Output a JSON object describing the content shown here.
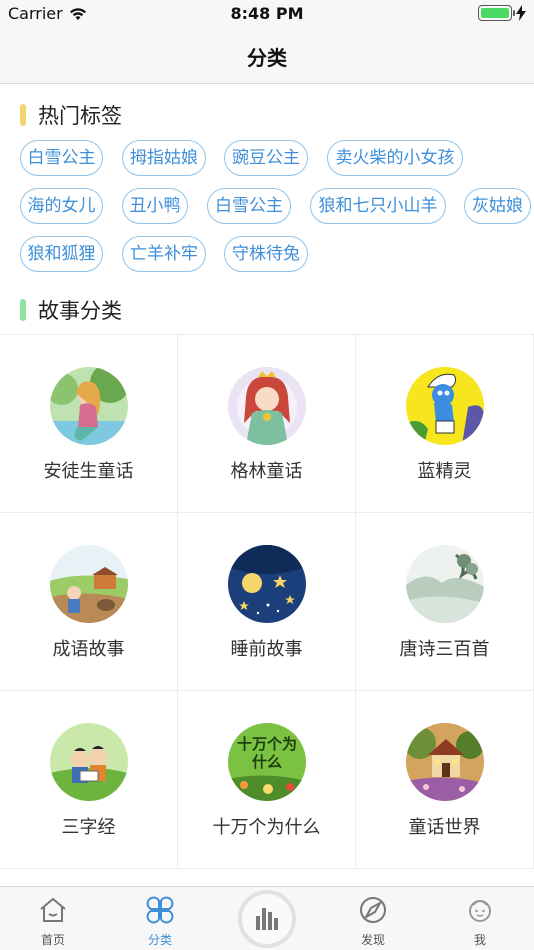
{
  "status": {
    "carrier": "Carrier",
    "time": "8:48 PM"
  },
  "nav": {
    "title": "分类"
  },
  "hot_tags": {
    "title": "热门标签",
    "accent": "#f3d36b",
    "items": [
      "白雪公主",
      "拇指姑娘",
      "豌豆公主",
      "卖火柴的小女孩",
      "海的女儿",
      "丑小鸭",
      "白雪公主",
      "狼和七只小山羊",
      "灰姑娘",
      "狼和狐狸",
      "亡羊补牢",
      "守株待兔"
    ]
  },
  "categories": {
    "title": "故事分类",
    "accent": "#8ee3a3",
    "items": [
      {
        "label": "安徒生童话",
        "icon": "mermaid-art-icon"
      },
      {
        "label": "格林童话",
        "icon": "princess-art-icon"
      },
      {
        "label": "蓝精灵",
        "icon": "smurf-art-icon"
      },
      {
        "label": "成语故事",
        "icon": "farm-art-icon"
      },
      {
        "label": "睡前故事",
        "icon": "night-moon-art-icon"
      },
      {
        "label": "唐诗三百首",
        "icon": "ink-landscape-art-icon"
      },
      {
        "label": "三字经",
        "icon": "reading-kids-art-icon"
      },
      {
        "label": "十万个为什么",
        "icon": "why-book-art-icon",
        "art_text": "十万个为什么"
      },
      {
        "label": "童话世界",
        "icon": "fairy-cottage-art-icon"
      }
    ]
  },
  "tabbar": {
    "tabs": [
      {
        "label": "首页",
        "icon": "home-icon"
      },
      {
        "label": "分类",
        "icon": "category-icon",
        "active": true
      },
      {
        "label": "播放",
        "icon": "audio-bars-icon"
      },
      {
        "label": "发现",
        "icon": "discover-icon"
      },
      {
        "label": "我",
        "icon": "profile-icon"
      }
    ],
    "active_color": "#3e8fd8"
  }
}
